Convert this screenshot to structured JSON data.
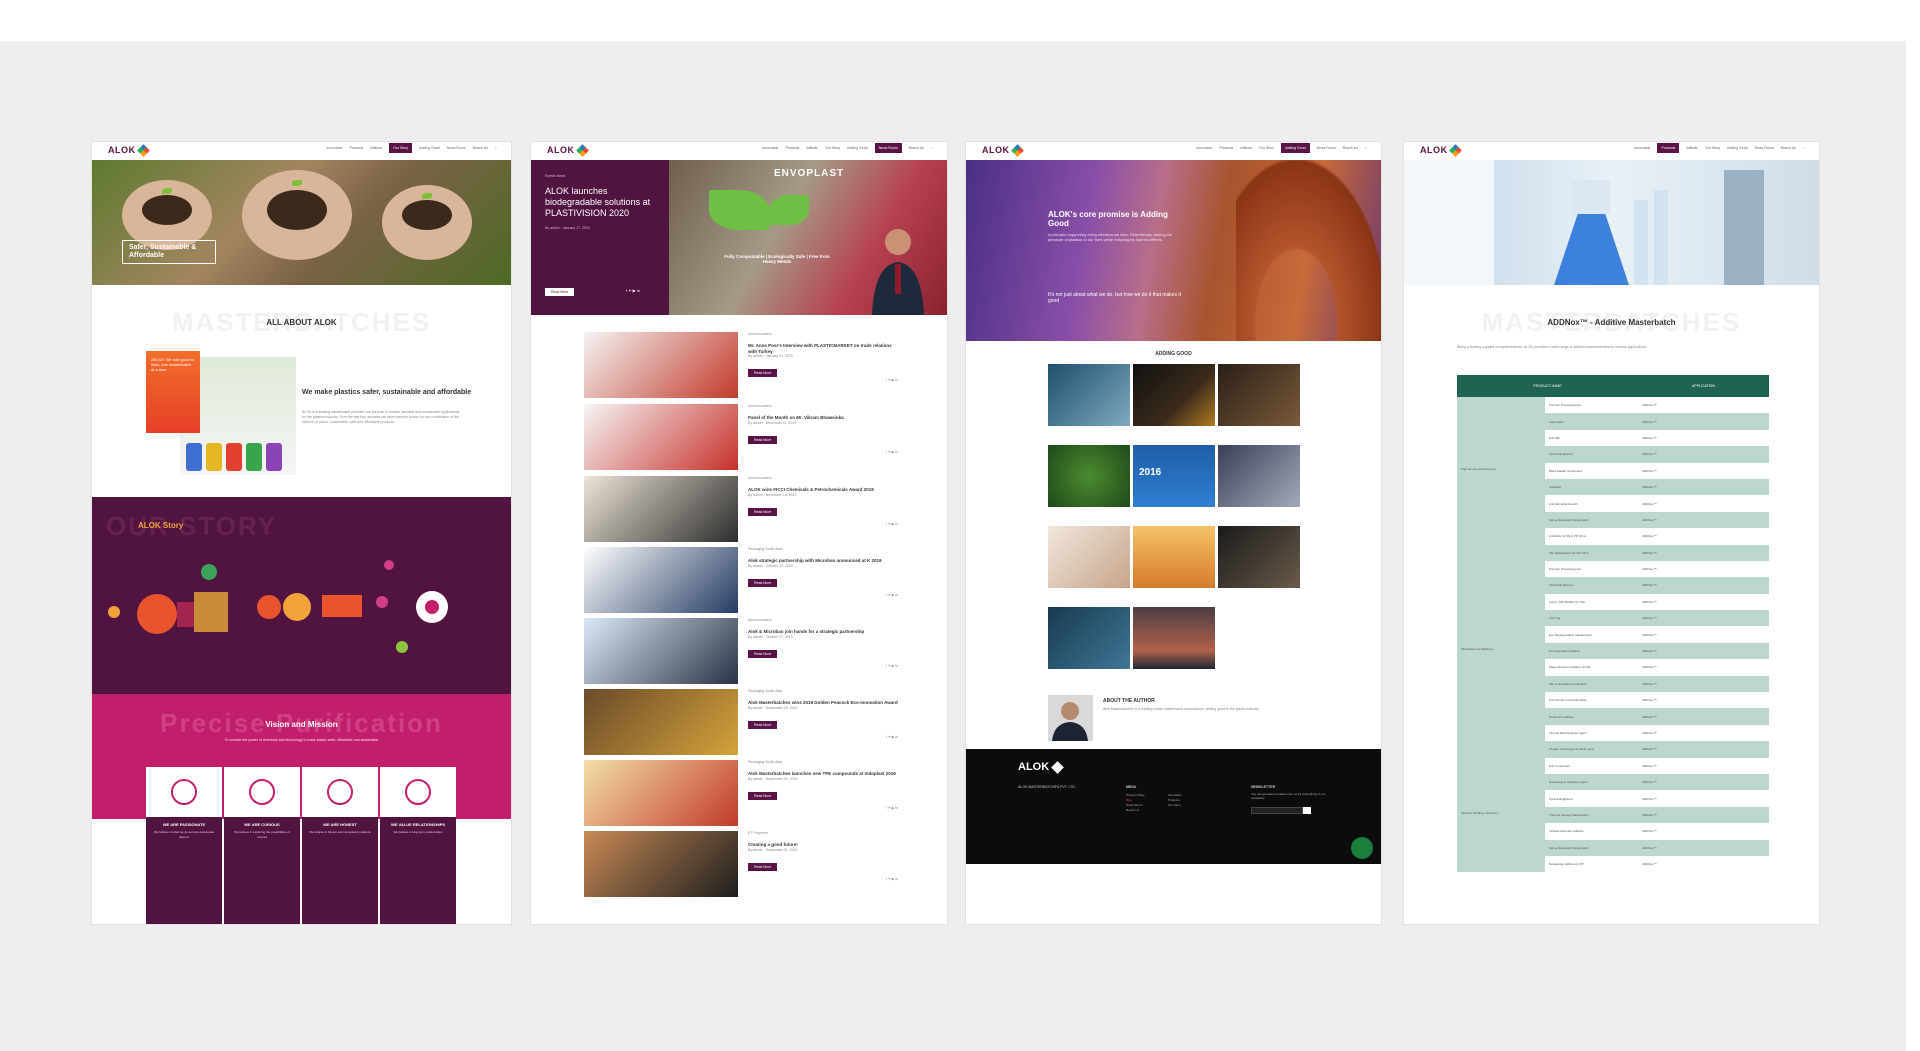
{
  "page": {
    "accent": "#5a1346",
    "magenta": "#c11f6c",
    "green": "#1f6452"
  },
  "brand": {
    "logo": "ALOK"
  },
  "nav": {
    "items": [
      "Innovation",
      "Products",
      "Attitude",
      "Our Story",
      "Adding Good",
      "News Room",
      "Reach Us"
    ],
    "search_icon": "search-icon"
  },
  "panel1": {
    "hero_tagline": "Safer, Sustainable & Affordable",
    "ghost_heading": "MASTERBATCHES",
    "section_title": "ALL ABOUT ALOK",
    "about_card": "ABOUT We add good to lives, one masterbatch at a time",
    "about_heading": "We make plastics safer, sustainable and affordable",
    "about_text": "ALOK is a leading masterbatch provider, our purpose to enable, sensible and sustainable applications for the plastics industry. Over the last four decades we have become known for our contribution of the science of colour, sustainable, safe and affordable products.",
    "story_ghost": "OUR STORY",
    "story_title": "ALOK Story",
    "vision_ghost": "Precise Purification",
    "vision_title": "Vision and Mission",
    "vision_text": "To unleash the power of chemistry and technology to make plastic safer, affordable and sustainable",
    "values": [
      {
        "title": "WE ARE PASSIONATE",
        "text": "We believe in what we do and are passionate about it"
      },
      {
        "title": "WE ARE CURIOUS",
        "text": "We believe in exploring the possibilities of science"
      },
      {
        "title": "WE ARE HONEST",
        "text": "We believe in honest and transparent relations"
      },
      {
        "title": "WE VALUE RELATIONSHIPS",
        "text": "We believe in long term relationships"
      }
    ]
  },
  "panel2": {
    "hero_kicker": "Events News",
    "hero_title": "ALOK launches biodegradable solutions at PLASTIVISION 2020",
    "hero_meta": "By admin · January 17, 2020",
    "hero_button": "Read More",
    "hero_banner": "ENVOPLAST",
    "hero_subbanner": "Fully Compostable | Ecologically Safe | Free from Heavy Metals",
    "news": [
      {
        "cat": "Announcement",
        "title": "Mr. Anns Poor's Interview with PLASTICMARKET on trade relations with Turkey",
        "meta": "By admin · January 21, 2020",
        "btn": "Read More"
      },
      {
        "cat": "Announcement",
        "title": "Panel of the Month on Mr. Vikram Bhawsinka",
        "meta": "By admin · December 11, 2019",
        "btn": "Read More"
      },
      {
        "cat": "Announcement",
        "title": "ALOK wins FICCI Chemicals & Petrochemicals Award 2019",
        "meta": "By admin · November 19, 2019",
        "btn": "Read More"
      },
      {
        "cat": "Packaging South Asia",
        "title": "Alok strategic partnership with Microban announced at K 2019",
        "meta": "By admin · October 30, 2019",
        "btn": "Read More"
      },
      {
        "cat": "Announcement",
        "title": "Alok & Microban join hands for a strategic partnership",
        "meta": "By admin · October 17, 2019",
        "btn": "Read More"
      },
      {
        "cat": "Packaging South Asia",
        "title": "Alok Masterbatches wins 2019 Golden Peacock Eco-innovation Award",
        "meta": "By admin · September 25, 2019",
        "btn": "Read More"
      },
      {
        "cat": "Packaging South Asia",
        "title": "Alok Masterbatches launches new TPE compounds at Indoplast 2019",
        "meta": "By admin · September 05, 2019",
        "btn": "Read More"
      },
      {
        "cat": "ET Polymers",
        "title": "Creating a good future!",
        "meta": "By admin · September 01, 2019",
        "btn": "Read More"
      }
    ]
  },
  "panel3": {
    "hero_title": "ALOK's core promise is Adding Good",
    "hero_text": "A principle supporting every decision we take. Relentlessly, adding the pleasure of plastics to our lives while reducing its harmful effects.",
    "hero_quote": "It's not just about what we do, but how we do it that makes it good",
    "grid_title": "ADDING GOOD",
    "author_title": "ABOUT THE AUTHOR",
    "author_text": "Alok Masterbatches is a leading Indian masterbatch manufacturer adding good to the plastic industry.",
    "footer_logo": "ALOK",
    "footer_company": "ALOK MASTERBATCHES PVT. LTD.",
    "footer_menu_title": "MENU",
    "footer_newsletter_title": "NEWSLETTER",
    "footer_newsletter_text": "You can get latest updates from us by subscribing to our newsletter",
    "footer_email_placeholder": "Email",
    "footer_menu": [
      "Privacy Policy",
      "Blog",
      "News Room",
      "Reach Us",
      "Innovation",
      "Products",
      "Our Story"
    ]
  },
  "panel4": {
    "ghost_heading": "MASTERBATCHES",
    "title": "ADDNox™ - Additive Masterbatch",
    "intro": "Being a leading supplier of masterbatches, ALOK provides a wide range of additive masterbatches for various applications.",
    "col_product": "PRODUCT NAME",
    "col_application": "APPLICATION",
    "categories": [
      "High Density Polyethylene",
      "Miscellaneous Additives",
      "Injection Molding / Extrusion"
    ],
    "rows": [
      "Polymer Processing Aid",
      "Antioxidant",
      "Anti Slip",
      "Optical Brightener",
      "Black Master Compound",
      "Antistatic",
      "Anti-Microbial Growth",
      "Flame Retardant Masterbatch",
      "Antiblock for PE & PP Films",
      "Slip Masterbatch for PE Films",
      "Polymer Processing Aid",
      "Optical Brightener",
      "Active Cliff Modifier for Talc",
      "Anti Fog",
      "Eco Biodegradable Masterbatch",
      "Pro-Degradant Additive",
      "Water Absorber Additive for PE",
      "Slip & Antistatic Combination",
      "Anti Termite & Anti Microbial",
      "Desiccant Additive",
      "Internal Mold Release Agent",
      "Oxygen Scavenger for Multi Layer",
      "Anti Counterfeit",
      "Nucleating & Clarifying Agent",
      "Optical Brightener",
      "Thermal Storage Masterbatch",
      "Infrared Absorber Additive",
      "Flame Retardant Masterbatch",
      "Nucleating Additive for PP"
    ],
    "app_label": "ADDNox™"
  }
}
